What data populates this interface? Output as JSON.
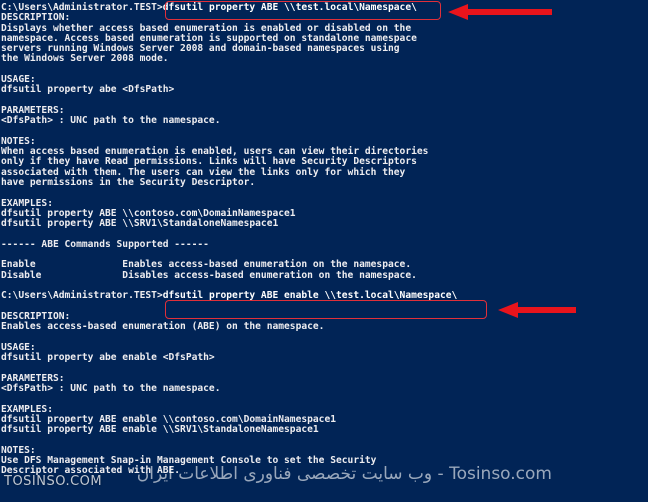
{
  "console": {
    "lines": [
      {
        "prompt": "C:\\Users\\Administrator.TEST>",
        "command": "dfsutil property ABE \\\\test.local\\Namespace\\"
      },
      {
        "text": "DESCRIPTION:"
      },
      {
        "text": "Displays whether access based enumeration is enabled or disabled on the"
      },
      {
        "text": "namespace. Access based enumeration is supported on standalone namespace"
      },
      {
        "text": "servers running Windows Server 2008 and domain-based namespaces using"
      },
      {
        "text": "the Windows Server 2008 mode."
      },
      {
        "text": ""
      },
      {
        "text": "USAGE:"
      },
      {
        "text": "dfsutil property abe <DfsPath>"
      },
      {
        "text": ""
      },
      {
        "text": "PARAMETERS:"
      },
      {
        "text": "<DfsPath> : UNC path to the namespace."
      },
      {
        "text": ""
      },
      {
        "text": "NOTES:"
      },
      {
        "text": "When access based enumeration is enabled, users can view their directories"
      },
      {
        "text": "only if they have Read permissions. Links will have Security Descriptors"
      },
      {
        "text": "associated with them. The users can view the links only for which they"
      },
      {
        "text": "have permissions in the Security Descriptor."
      },
      {
        "text": ""
      },
      {
        "text": "EXAMPLES:"
      },
      {
        "text": "dfsutil property ABE \\\\contoso.com\\DomainNamespace1"
      },
      {
        "text": "dfsutil property ABE \\\\SRV1\\StandaloneNamespace1"
      },
      {
        "text": ""
      },
      {
        "text": "------ ABE Commands Supported ------"
      },
      {
        "text": ""
      },
      {
        "text": "Enable               Enables access-based enumeration on the namespace."
      },
      {
        "text": "Disable              Disables access-based enumeration on the namespace."
      },
      {
        "text": ""
      },
      {
        "prompt": "C:\\Users\\Administrator.TEST>",
        "command": "dfsutil property ABE enable \\\\test.local\\Namespace\\"
      },
      {
        "text": ""
      },
      {
        "text": "DESCRIPTION:"
      },
      {
        "text": "Enables access-based enumeration (ABE) on the namespace."
      },
      {
        "text": ""
      },
      {
        "text": "USAGE:"
      },
      {
        "text": "dfsutil property abe enable <DfsPath>"
      },
      {
        "text": ""
      },
      {
        "text": "PARAMETERS:"
      },
      {
        "text": "<DfsPath> : UNC path to the namespace."
      },
      {
        "text": ""
      },
      {
        "text": "EXAMPLES:"
      },
      {
        "text": "dfsutil property ABE enable \\\\contoso.com\\DomainNamespace1"
      },
      {
        "text": "dfsutil property ABE enable \\\\SRV1\\StandaloneNamespace1"
      },
      {
        "text": ""
      },
      {
        "text": "NOTES:"
      },
      {
        "text": "Use DFS Management Snap-in Management Console to set the Security"
      },
      {
        "text": "Descriptor associated with ABE."
      }
    ]
  },
  "watermark": {
    "left_text": "TOSINSO.COM",
    "right_text": "وب سایت تخصصی فناوری اطلاعات ایران - Tosinso.com"
  },
  "colors": {
    "background": "#012456",
    "text": "#eeedf0",
    "highlight": "#e0303a",
    "arrow": "#e8141c"
  }
}
